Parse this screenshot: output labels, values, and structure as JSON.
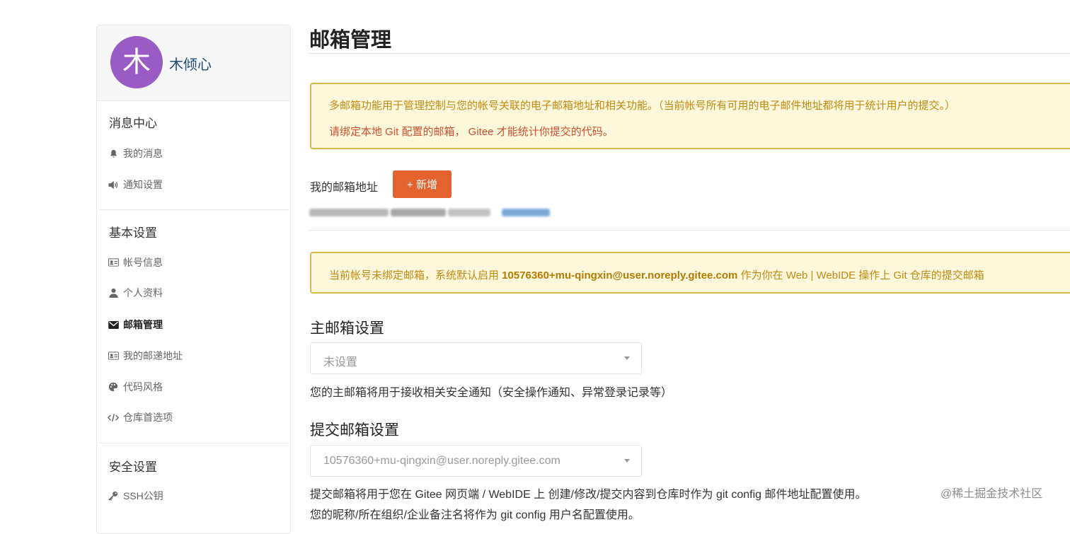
{
  "user": {
    "avatar_char": "木",
    "name": "木倾心"
  },
  "sidebar": {
    "groups": [
      {
        "title": "消息中心",
        "items": [
          {
            "label": "我的消息",
            "icon": "bell-icon"
          },
          {
            "label": "通知设置",
            "icon": "speaker-icon"
          }
        ]
      },
      {
        "title": "基本设置",
        "items": [
          {
            "label": "帐号信息",
            "icon": "id-card-icon"
          },
          {
            "label": "个人资料",
            "icon": "user-icon"
          },
          {
            "label": "邮箱管理",
            "icon": "envelope-icon",
            "active": true
          },
          {
            "label": "我的邮递地址",
            "icon": "address-card-icon"
          },
          {
            "label": "代码风格",
            "icon": "palette-icon"
          },
          {
            "label": "仓库首选项",
            "icon": "code-icon"
          }
        ]
      },
      {
        "title": "安全设置",
        "items": [
          {
            "label": "SSH公钥",
            "icon": "key-icon"
          }
        ]
      }
    ]
  },
  "main": {
    "title": "邮箱管理",
    "notice1": {
      "line1": "多邮箱功能用于管理控制与您的帐号关联的电子邮箱地址和相关功能。（当前帐号所有可用的电子邮件地址都将用于统计用户的提交。）",
      "line2": "请绑定本地 Git 配置的邮箱， Gitee 才能统计你提交的代码。"
    },
    "my_email_label": "我的邮箱地址",
    "add_button": "+ 新增",
    "notice2": {
      "prefix": "当前帐号未绑定邮箱，系统默认启用 ",
      "email": "10576360+mu-qingxin@user.noreply.gitee.com",
      "suffix": " 作为你在 Web | WebIDE 操作上 Git 仓库的提交邮箱"
    },
    "primary": {
      "heading": "主邮箱设置",
      "selected": "未设置",
      "help": "您的主邮箱将用于接收相关安全通知（安全操作通知、异常登录记录等）"
    },
    "commit": {
      "heading": "提交邮箱设置",
      "selected": "10576360+mu-qingxin@user.noreply.gitee.com",
      "help1": "提交邮箱将用于您在 Gitee 网页端 / WebIDE 上 创建/修改/提交内容到仓库时作为 git config 邮件地址配置使用。",
      "help2": "您的昵称/所在组织/企业备注名将作为 git config 用户名配置使用。"
    }
  },
  "watermark": "@稀土掘金技术社区",
  "colors": {
    "accent": "#e4622f",
    "notice_bg": "#fdf7dc",
    "notice_border": "#d9b84a",
    "avatar": "#9a5cc4"
  }
}
